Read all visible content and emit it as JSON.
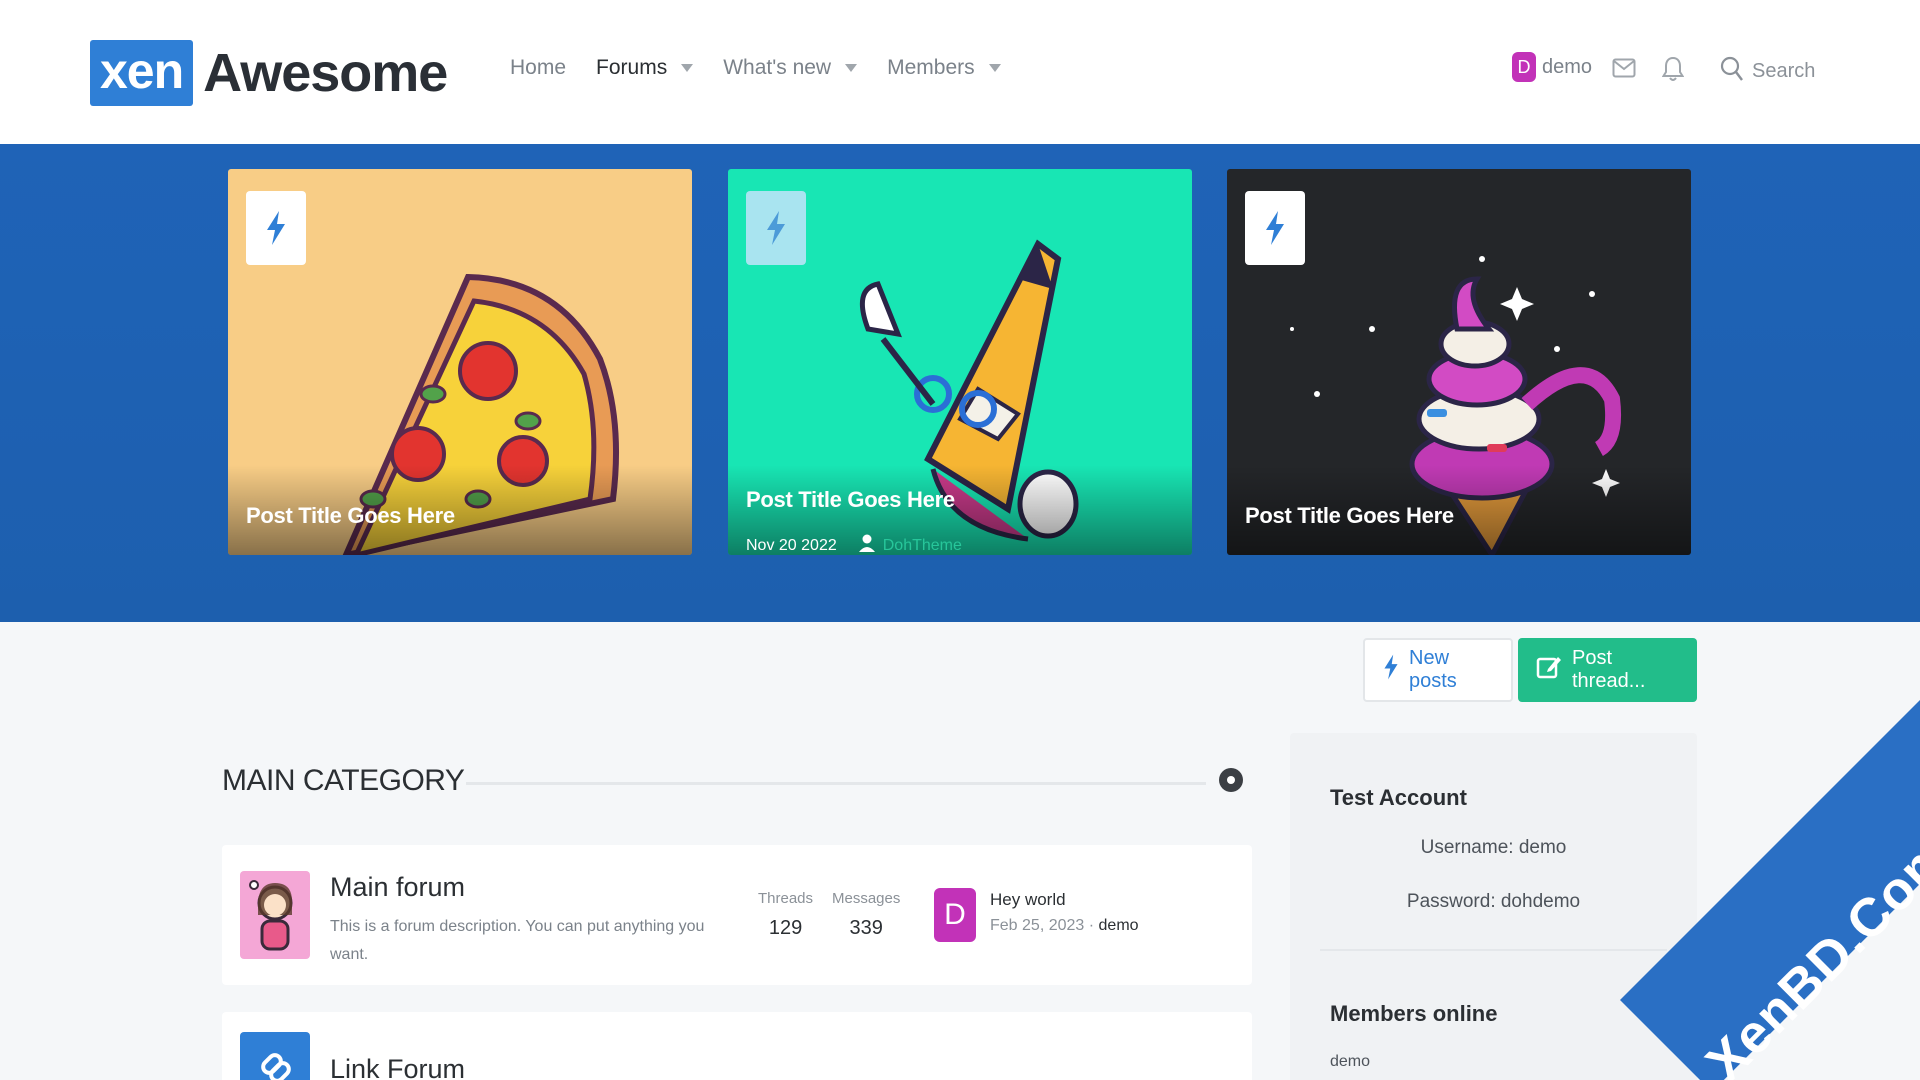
{
  "logo": {
    "box_text": "xen",
    "text": "Awesome"
  },
  "nav": [
    {
      "label": "Home",
      "active": false,
      "caret": false
    },
    {
      "label": "Forums",
      "active": true,
      "caret": true
    },
    {
      "label": "What's new",
      "active": false,
      "caret": true
    },
    {
      "label": "Members",
      "active": false,
      "caret": true
    }
  ],
  "user": {
    "avatar_letter": "D",
    "name": "demo"
  },
  "search": {
    "label": "Search"
  },
  "icons": {
    "inbox": "envelope-icon",
    "alerts": "bell-icon",
    "search": "search-icon",
    "badge": "lightning-icon"
  },
  "cards": [
    {
      "title": "Post Title Goes Here",
      "theme": "pizza",
      "bg": "#f8cd86"
    },
    {
      "title": "Post Title Goes Here",
      "theme": "pencil",
      "bg": "#18e6b4",
      "date": "Nov 20 2022",
      "author": "DohTheme"
    },
    {
      "title": "Post Title Goes Here",
      "theme": "ice-cream",
      "bg": "#242629"
    }
  ],
  "actions": {
    "new_posts": "New posts",
    "post_thread": "Post thread..."
  },
  "category": {
    "title": "MAIN CATEGORY"
  },
  "forums": [
    {
      "name": "Main forum",
      "description": "This is a forum description. You can put anything you want.",
      "threads_label": "Threads",
      "threads": "129",
      "messages_label": "Messages",
      "messages": "339",
      "last_avatar": "D",
      "last_title": "Hey world",
      "last_date": "Feb 25, 2023",
      "last_sep": " · ",
      "last_user": "demo"
    },
    {
      "name": "Link Forum"
    }
  ],
  "sidebar": {
    "test_title": "Test Account",
    "username_line": "Username: demo",
    "password_line": "Password: dohdemo",
    "online_title": "Members online",
    "online_member": "demo"
  },
  "watermark": "XenBD.Com",
  "colors": {
    "brand": "#2f7fd6",
    "hero": "#1f63b7",
    "post_button": "#22bd8a",
    "avatar": "#c232b8"
  }
}
